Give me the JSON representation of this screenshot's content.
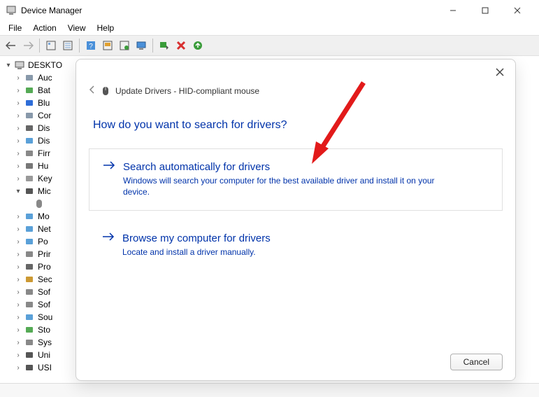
{
  "window": {
    "title": "Device Manager"
  },
  "menubar": [
    "File",
    "Action",
    "View",
    "Help"
  ],
  "tree": {
    "root": "DESKTO",
    "nodes": [
      {
        "label": "Auc"
      },
      {
        "label": "Bat"
      },
      {
        "label": "Blu"
      },
      {
        "label": "Cor"
      },
      {
        "label": "Dis"
      },
      {
        "label": "Dis"
      },
      {
        "label": "Firr"
      },
      {
        "label": "Hu"
      },
      {
        "label": "Key"
      },
      {
        "label": "Mic",
        "expanded": true
      },
      {
        "label": "Mo"
      },
      {
        "label": "Net"
      },
      {
        "label": "Po"
      },
      {
        "label": "Prir"
      },
      {
        "label": "Pro"
      },
      {
        "label": "Sec"
      },
      {
        "label": "Sof"
      },
      {
        "label": "Sof"
      },
      {
        "label": "Sou"
      },
      {
        "label": "Sto"
      },
      {
        "label": "Sys"
      },
      {
        "label": "Uni"
      },
      {
        "label": "USI"
      }
    ]
  },
  "dialog": {
    "title": "Update Drivers - HID-compliant mouse",
    "question": "How do you want to search for drivers?",
    "options": [
      {
        "title": "Search automatically for drivers",
        "desc": "Windows will search your computer for the best available driver and install it on your device."
      },
      {
        "title": "Browse my computer for drivers",
        "desc": "Locate and install a driver manually."
      }
    ],
    "cancel": "Cancel"
  }
}
